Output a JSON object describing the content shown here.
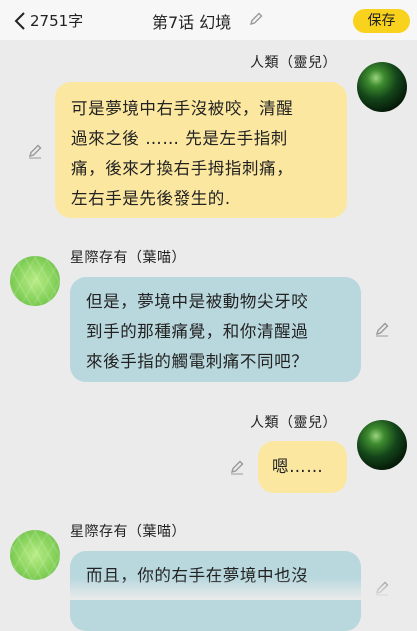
{
  "header": {
    "word_count": "2751字",
    "episode_title": "第7话 幻境",
    "save_label": "保存"
  },
  "messages": [
    {
      "speaker": "人類（靈兒）",
      "text": "可是夢境中右手沒被咬，清醒\n過來之後 …… 先是左手指刺\n痛，後來才換右手拇指刺痛，\n左右手是先後發生的."
    },
    {
      "speaker": "星際存有（葉喵）",
      "text": "但是，夢境中是被動物尖牙咬\n到手的那種痛覺，和你清醒過\n來後手指的觸電刺痛不同吧？"
    },
    {
      "speaker": "人類（靈兒）",
      "text": "嗯……"
    },
    {
      "speaker": "星際存有（葉喵）",
      "text": "而且，你的右手在夢境中也沒"
    }
  ],
  "colors": {
    "accent": "#f8d21c",
    "human_bubble": "#fbe7a0",
    "being_bubble": "#b9d8de",
    "background": "#ebebeb"
  },
  "icons": {
    "back": "chevron-left-icon",
    "edit": "pencil-icon"
  }
}
